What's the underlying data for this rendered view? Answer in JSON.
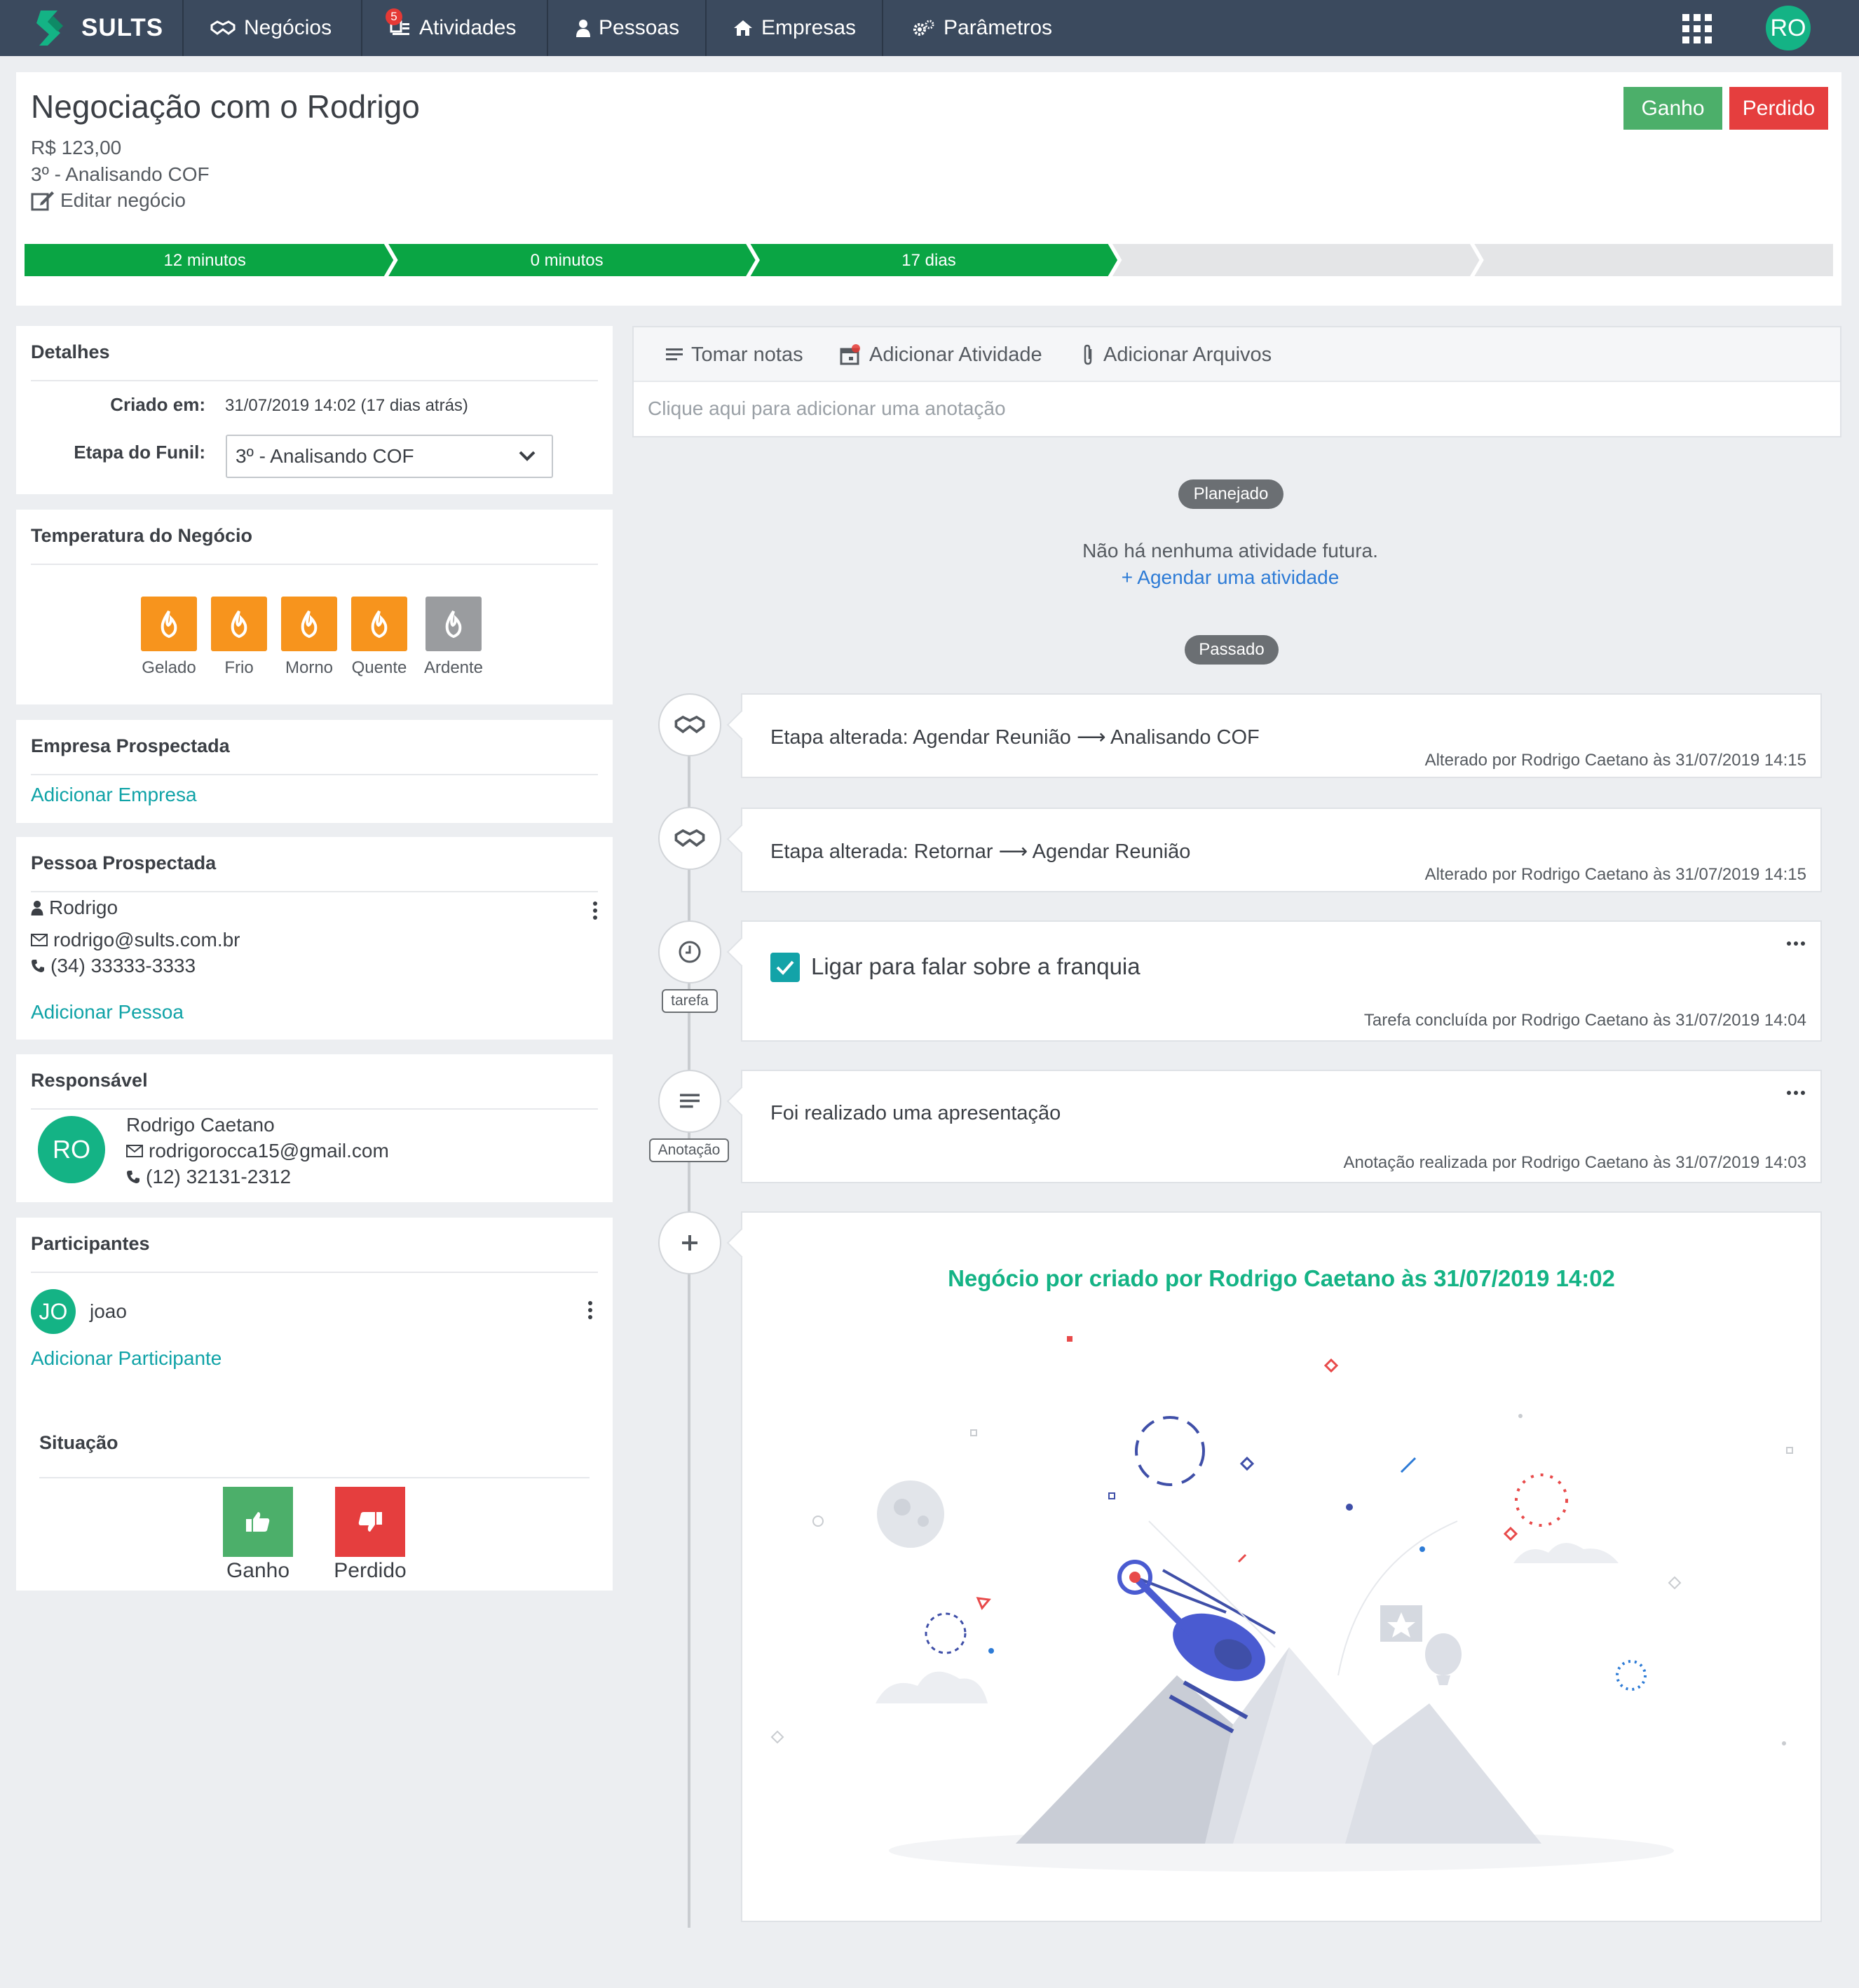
{
  "nav": {
    "brand": "SULTS",
    "items": [
      {
        "label": "Negócios",
        "icon": "handshake-icon"
      },
      {
        "label": "Atividades",
        "icon": "calendar-list-icon",
        "badge": "5"
      },
      {
        "label": "Pessoas",
        "icon": "user-icon"
      },
      {
        "label": "Empresas",
        "icon": "building-icon"
      },
      {
        "label": "Parâmetros",
        "icon": "gears-icon"
      }
    ],
    "user_initials": "RO"
  },
  "deal": {
    "title": "Negociação com o Rodrigo",
    "value": "R$ 123,00",
    "stage": "3º - Analisando COF",
    "edit_label": "Editar negócio",
    "won_label": "Ganho",
    "lost_label": "Perdido"
  },
  "pipeline": {
    "stages": [
      "12 minutos",
      "0 minutos",
      "17 dias",
      "",
      ""
    ],
    "completed_count": 3,
    "colors": {
      "done": "#0aa544",
      "todo": "#e4e5e7"
    }
  },
  "details": {
    "title": "Detalhes",
    "created_label": "Criado em:",
    "created_value": "31/07/2019 14:02 (17 dias atrás)",
    "funnel_label": "Etapa do Funil:",
    "funnel_value": "3º - Analisando COF"
  },
  "temperature": {
    "title": "Temperatura do Negócio",
    "levels": [
      "Gelado",
      "Frio",
      "Morno",
      "Quente",
      "Ardente"
    ],
    "active_count": 4,
    "colors": {
      "active": "#f7941d",
      "inactive": "#9a9c9f"
    }
  },
  "company": {
    "title": "Empresa Prospectada",
    "add_label": "Adicionar Empresa"
  },
  "person": {
    "title": "Pessoa Prospectada",
    "name": "Rodrigo",
    "email": "rodrigo@sults.com.br",
    "phone": "(34) 33333-3333",
    "add_label": "Adicionar Pessoa"
  },
  "owner": {
    "title": "Responsável",
    "initials": "RO",
    "name": "Rodrigo Caetano",
    "email": "rodrigorocca15@gmail.com",
    "phone": "(12) 32131-2312"
  },
  "participants": {
    "title": "Participantes",
    "items": [
      {
        "initials": "JO",
        "name": "joao"
      }
    ],
    "add_label": "Adicionar Participante"
  },
  "situation": {
    "title": "Situação",
    "won_label": "Ganho",
    "lost_label": "Perdido"
  },
  "notes": {
    "tabs": [
      "Tomar notas",
      "Adicionar Atividade",
      "Adicionar Arquivos"
    ],
    "placeholder": "Clique aqui para adicionar uma anotação"
  },
  "timeline": {
    "planned_label": "Planejado",
    "planned_empty": "Não há nenhuma atividade futura.",
    "schedule_link": "+ Agendar uma atividade",
    "past_label": "Passado",
    "events": [
      {
        "text": "Etapa alterada: Agendar Reunião ⟶ Analisando COF",
        "meta": "Alterado por Rodrigo Caetano às 31/07/2019 14:15"
      },
      {
        "text": "Etapa alterada: Retornar ⟶ Agendar Reunião",
        "meta": "Alterado por Rodrigo Caetano às 31/07/2019 14:15"
      },
      {
        "tag": "tarefa",
        "text": "Ligar para falar sobre a franquia",
        "meta": "Tarefa concluída por Rodrigo Caetano às 31/07/2019 14:04",
        "done": true
      },
      {
        "tag": "Anotação",
        "text": "Foi realizado uma apresentação",
        "meta": "Anotação realizada por Rodrigo Caetano às 31/07/2019 14:03"
      }
    ],
    "created_text": "Negócio por criado por Rodrigo Caetano às 31/07/2019 14:02"
  }
}
